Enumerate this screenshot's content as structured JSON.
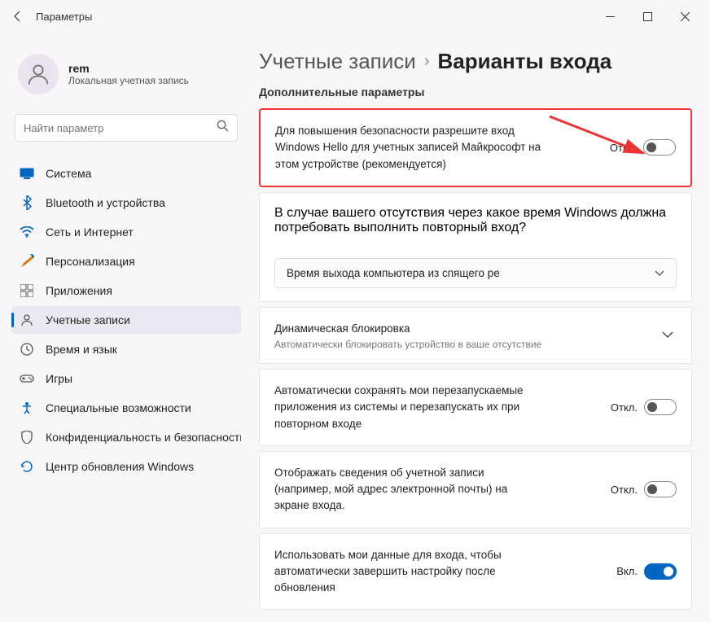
{
  "window": {
    "title": "Параметры"
  },
  "user": {
    "name": "rem",
    "subtitle": "Локальная учетная запись"
  },
  "search": {
    "placeholder": "Найти параметр"
  },
  "nav": {
    "items": [
      {
        "label": "Система"
      },
      {
        "label": "Bluetooth и устройства"
      },
      {
        "label": "Сеть и Интернет"
      },
      {
        "label": "Персонализация"
      },
      {
        "label": "Приложения"
      },
      {
        "label": "Учетные записи"
      },
      {
        "label": "Время и язык"
      },
      {
        "label": "Игры"
      },
      {
        "label": "Специальные возможности"
      },
      {
        "label": "Конфиденциальность и безопасность"
      },
      {
        "label": "Центр обновления Windows"
      }
    ]
  },
  "breadcrumb": {
    "parent": "Учетные записи",
    "current": "Варианты входа"
  },
  "section_title": "Дополнительные параметры",
  "cards": {
    "hello": {
      "text": "Для повышения безопасности разрешите вход Windows Hello для учетных записей Майкрософт на этом устройстве (рекомендуется)",
      "status": "Откл."
    },
    "reauth": {
      "text": "В случае вашего отсутствия через какое время Windows должна потребовать выполнить повторный вход?",
      "dropdown": "Время выхода компьютера из спящего ре"
    },
    "dynamic": {
      "title": "Динамическая блокировка",
      "sub": "Автоматически блокировать устройство в ваше отсутствие"
    },
    "restart_apps": {
      "text": "Автоматически сохранять мои перезапускаемые приложения из системы и перезапускать их при повторном входе",
      "status": "Откл."
    },
    "show_account": {
      "text": "Отображать сведения об учетной записи (например, мой адрес электронной почты) на экране входа.",
      "status": "Откл."
    },
    "use_data": {
      "text": "Использовать мои данные для входа, чтобы автоматически завершить настройку после обновления",
      "status": "Вкл."
    }
  }
}
